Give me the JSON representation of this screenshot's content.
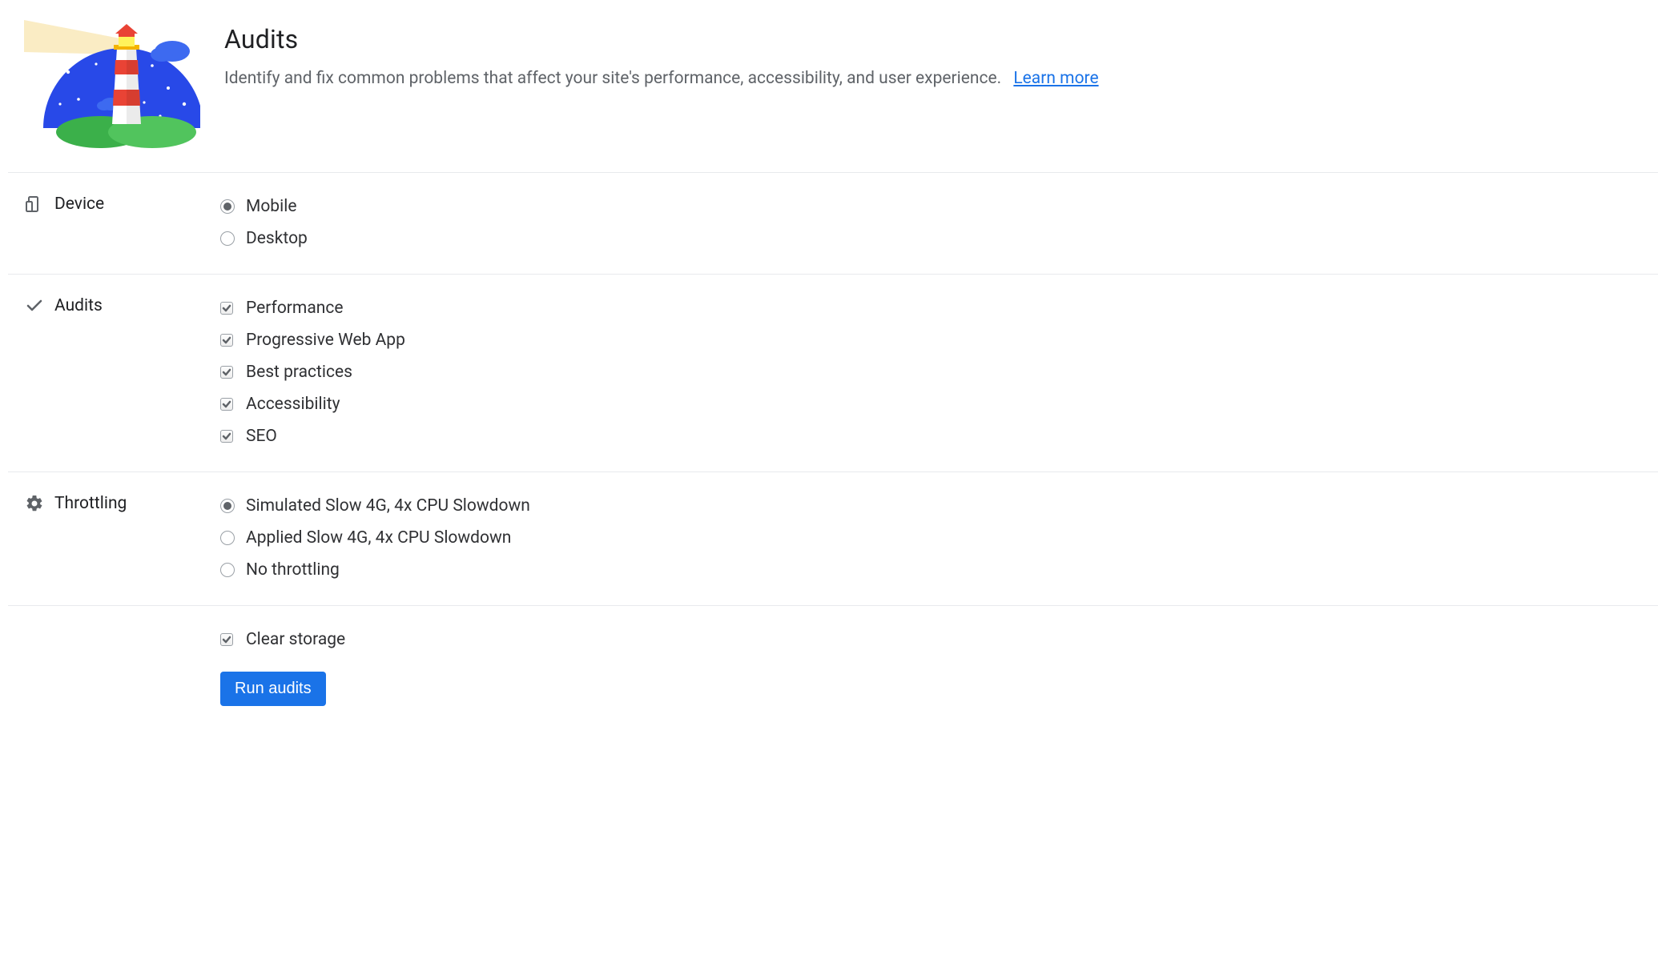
{
  "header": {
    "title": "Audits",
    "subtitle": "Identify and fix common problems that affect your site's performance, accessibility, and user experience.",
    "learn_more": "Learn more"
  },
  "sections": {
    "device": {
      "label": "Device",
      "options": [
        {
          "label": "Mobile",
          "selected": true
        },
        {
          "label": "Desktop",
          "selected": false
        }
      ]
    },
    "audits": {
      "label": "Audits",
      "options": [
        {
          "label": "Performance",
          "checked": true
        },
        {
          "label": "Progressive Web App",
          "checked": true
        },
        {
          "label": "Best practices",
          "checked": true
        },
        {
          "label": "Accessibility",
          "checked": true
        },
        {
          "label": "SEO",
          "checked": true
        }
      ]
    },
    "throttling": {
      "label": "Throttling",
      "options": [
        {
          "label": "Simulated Slow 4G, 4x CPU Slowdown",
          "selected": true
        },
        {
          "label": "Applied Slow 4G, 4x CPU Slowdown",
          "selected": false
        },
        {
          "label": "No throttling",
          "selected": false
        }
      ]
    },
    "storage": {
      "clear_storage_label": "Clear storage",
      "clear_storage_checked": true
    }
  },
  "actions": {
    "run_audits": "Run audits"
  }
}
